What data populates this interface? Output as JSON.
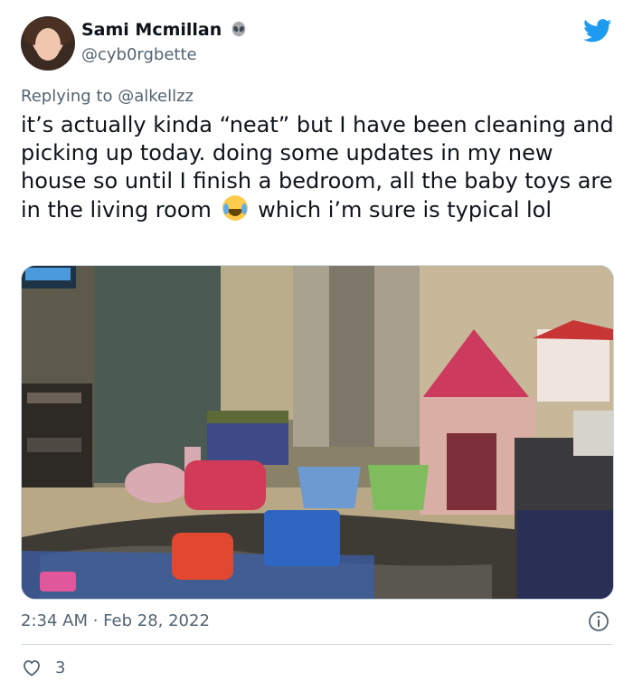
{
  "author": {
    "name": "Sami Mcmillan",
    "handle": "@cyb0rgbette",
    "badge_icon": "alien-icon"
  },
  "reply": {
    "prefix": "Replying to",
    "mention": "@alkellzz"
  },
  "tweet": {
    "text_before_emoji": "it’s actually kinda “neat” but I have been cleaning and picking up today. doing some updates in my new house so until I finish a bedroom, all the baby toys are in the living room",
    "emoji": "face-with-tears-of-joy-icon",
    "text_after_emoji": "which i’m sure is typical lol"
  },
  "media": {
    "icon": "photo-living-room-toys"
  },
  "meta": {
    "timestamp": "2:34 AM · Feb 28, 2022"
  },
  "engagement": {
    "likes": "3"
  },
  "colors": {
    "brand": "#1d9bf0",
    "secondary_text": "#536471",
    "border": "#cfd9de"
  }
}
